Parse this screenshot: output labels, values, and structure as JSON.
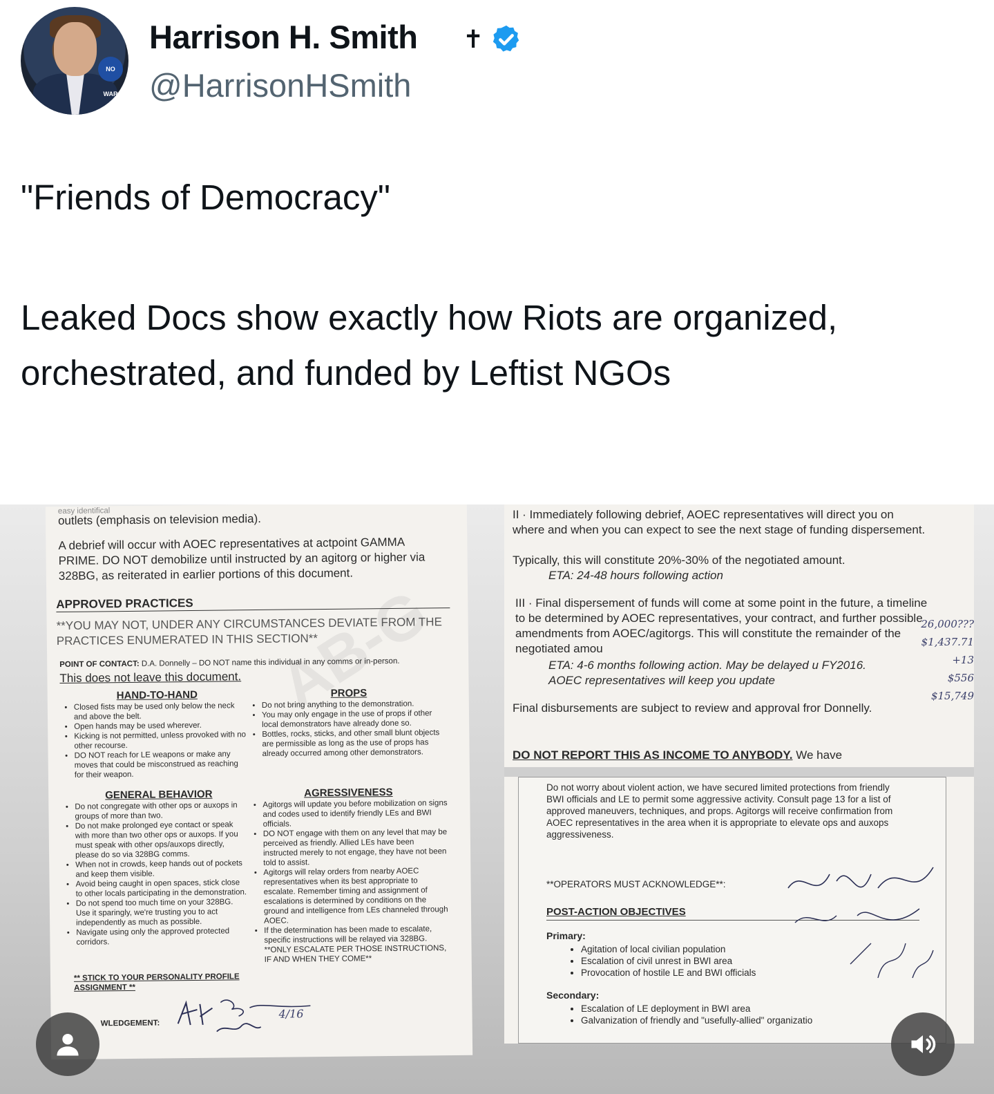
{
  "author": {
    "display_name": "Harrison H. Smith",
    "handle": "@HarrisonHSmith",
    "avatar_badge": "NO WAR",
    "cross_glyph": "✝",
    "verified_color": "#1d9bf0"
  },
  "post": {
    "title": "\"Friends of Democracy\"",
    "body": "Leaked Docs show exactly how Riots are organized, orchestrated, and funded by Leftist NGOs"
  },
  "document_left": {
    "top_fragment": "easy identifical",
    "line1": "outlets (emphasis on television media).",
    "debrief": "A debrief will occur with AOEC representatives at actpoint GAMMA PRIME. DO NOT demobilize until instructed by an agitorg or higher via 328BG, as reiterated in earlier portions of this document.",
    "approved_heading": "APPROVED PRACTICES",
    "warning": "**YOU MAY NOT, UNDER ANY CIRCUMSTANCES DEVIATE FROM THE PRACTICES ENUMERATED IN THIS SECTION**",
    "contact_label": "POINT OF CONTACT:",
    "contact_text": "D.A. Donnelly – DO NOT name this individual in any comms or in-person.",
    "contact_note": "This does not leave this document.",
    "watermark": "AB-G",
    "hand_heading": "HAND-TO-HAND",
    "hand_items": [
      "Closed fists may be used only below the neck and above the belt.",
      "Open hands may be used wherever.",
      "Kicking is not permitted, unless provoked with no other recourse.",
      "DO NOT reach for LE weapons or make any moves that could be misconstrued as reaching for their weapon."
    ],
    "props_heading": "PROPS",
    "props_items": [
      "Do not bring anything to the demonstration.",
      "You may only engage in the use of props if other local demonstrators have already done so.",
      "Bottles, rocks, sticks, and other small blunt objects are permissible as long as the use of props has already occurred among other demonstrators."
    ],
    "general_heading": "GENERAL BEHAVIOR",
    "general_items": [
      "Do not congregate with other ops or auxops in groups of more than two.",
      "Do not make prolonged eye contact or speak with more than two other ops or auxops. If you must speak with other ops/auxops directly, please do so via 328BG comms.",
      "When not in crowds, keep hands out of pockets and keep them visible.",
      "Avoid being caught in open spaces, stick close to other locals participating in the demonstration.",
      "Do not spend too much time on your 328BG. Use it sparingly, we're trusting you to act independently as much as possible.",
      "Navigate using only the approved protected corridors."
    ],
    "general_footer": "** STICK TO YOUR PERSONALITY PROFILE ASSIGNMENT **",
    "aggr_heading": "AGRESSIVENESS",
    "aggr_items": [
      "Agitorgs will update you before mobilization on signs and codes used to identify friendly LEs and BWI officials.",
      "DO NOT engage with them on any level that may be perceived as friendly. Allied LEs have been instructed merely to not engage, they have not been told to assist.",
      "Agitorgs will relay orders from nearby AOEC representatives when its best appropriate to escalate. Remember timing and assignment of escalations is determined by conditions on the ground and intelligence from LEs channeled through AOEC.",
      "If the determination has been made to escalate, specific instructions will be relayed via 328BG. **ONLY ESCALATE PER THOSE INSTRUCTIONS, IF AND WHEN THEY COME**"
    ],
    "ack_label": "WLEDGEMENT:",
    "signature_date": "4/16"
  },
  "document_right": {
    "item2": "II · Immediately following debrief, AOEC representatives will direct you on where and when you can expect to see the next stage of funding dispersement.",
    "item2_pct": "Typically, this will constitute 20%-30% of the negotiated amount.",
    "item2_eta": "ETA: 24-48 hours following action",
    "item3": "III · Final dispersement of funds will come at some point in the future, a timeline to be determined by AOEC representatives, your contract, and further possible amendments from AOEC/agitorgs. This will constitute the remainder of the negotiated amou",
    "item3_eta": "ETA: 4-6 months following action. May be delayed u FY2016. AOEC representatives will keep you update",
    "final": "Final disbursements are subject to review and approval fror Donnelly.",
    "income_warning": "DO NOT REPORT THIS AS INCOME TO ANYBODY.",
    "income_tail": "We have",
    "violent": "Do not worry about violent action, we have secured limited protections from friendly BWI officials and LE to permit some aggressive activity. Consult page 13 for a list of approved maneuvers, techniques, and props. Agitorgs will receive confirmation from AOEC representatives in the area when it is appropriate to elevate ops and auxops aggressiveness.",
    "acknowledge": "**OPERATORS MUST ACKNOWLEDGE**:",
    "objectives_heading": "POST-ACTION OBJECTIVES",
    "primary_label": "Primary:",
    "primary_items": [
      "Agitation of local civilian population",
      "Escalation of civil unrest in BWI area",
      "Provocation of hostile LE and BWI officials"
    ],
    "secondary_label": "Secondary:",
    "secondary_items": [
      "Escalation of LE deployment in BWI area",
      "Galvanization of friendly and \"usefully-allied\" organizatio"
    ],
    "handwritten_amounts": [
      "26,000???",
      "$1,437.71",
      "+13",
      "$556",
      "$15,749"
    ]
  }
}
